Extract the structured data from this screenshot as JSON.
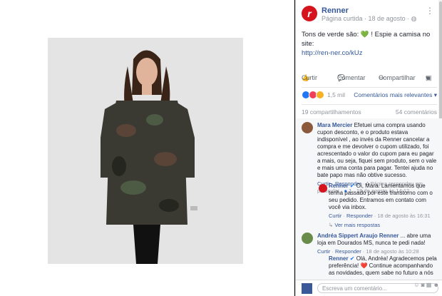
{
  "post": {
    "page_name": "Renner",
    "meta_type": "Página curtida",
    "meta_date": "18 de agosto",
    "text_line1": "Tons de verde são: 💚 ! Espie a camisa no site:",
    "text_link": "http://ren-ner.co/kUz"
  },
  "actions": {
    "like": "Curtir",
    "comment": "Comentar",
    "share": "Compartilhar"
  },
  "reactions": {
    "count": "1,5 mil",
    "sort_label": "Comentários mais relevantes"
  },
  "shares": {
    "label": "19 compartilhamentos",
    "comments": "54 comentários"
  },
  "comments": [
    {
      "name": "Mara Mercier",
      "text": "Efetuei uma compra usando cupon desconto, e o produto estava indisponível , ao invés da Renner cancelar a compra e me devolver o cupom utilizado, foi acrescentado o valor do cupom para eu pagar a mais, ou seja, fiquei sem produto, sem o vale e mais uma conta para pagar. Tentei ajuda no bate papo mas não obtive sucesso.",
      "like": "Curtir",
      "reply": "Responder",
      "status": "A Página respondeu em particular",
      "likes": "1",
      "date": "18 de agosto às 14:12"
    },
    {
      "name": "Renner",
      "text": "Oi, Mara. Lamentamos que tenha passado por este transtorno com o seu pedido. Entramos em contato com você via inbox.",
      "like": "Curtir",
      "reply": "Responder",
      "date": "18 de agosto às 16:31",
      "more": "Ver mais respostas"
    },
    {
      "name": "Andréa Sippert Araujo Renner",
      "text": "... abre uma loja em Dourados MS, nunca te pedi nada!",
      "like": "Curtir",
      "reply": "Responder",
      "date": "18 de agosto às 10:28"
    },
    {
      "name": "Renner",
      "text": "Olá, Andréa! Agradecemos pela preferência! ❤️ Continue acompanhando as novidades, quem sabe no futuro a nós possamos ser o Espaço lá :)"
    }
  ],
  "compose": {
    "placeholder": "Escreva um comentário..."
  },
  "colors": {
    "brand": "#d6141d",
    "link": "#365899",
    "like_blue": "#2078f4",
    "heart_red": "#f33e58"
  }
}
